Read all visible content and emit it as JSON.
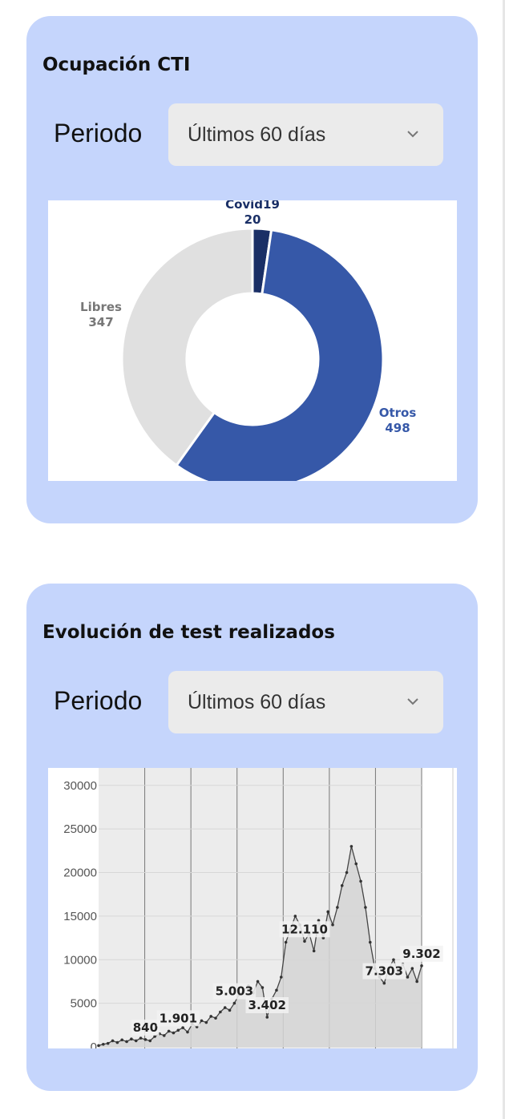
{
  "cti_card": {
    "title": "Ocupación CTI",
    "period_label": "Periodo",
    "period_selected": "Últimos 60 días",
    "chart_data": {
      "type": "pie",
      "donut": true,
      "slices": [
        {
          "label": "Covid19",
          "value": 20,
          "color": "#1a2f66",
          "display": "20"
        },
        {
          "label": "Otros",
          "value": 498,
          "color": "#3658a8",
          "display": "498"
        },
        {
          "label": "Libres",
          "value": 347,
          "color": "#e0e0e0",
          "display": "347"
        }
      ]
    }
  },
  "tests_card": {
    "title": "Evolución de test realizados",
    "period_label": "Periodo",
    "period_selected": "Últimos 60 días",
    "chart_data": {
      "type": "line",
      "ylim": [
        0,
        32000
      ],
      "yticks": [
        0,
        5000,
        10000,
        15000,
        20000,
        25000,
        30000
      ],
      "ytick_labels": [
        "0",
        "5000",
        "10000",
        "15000",
        "20000",
        "25000",
        "30000"
      ],
      "grid": true,
      "series": [
        {
          "x": [
            0,
            1,
            2,
            3,
            4,
            5,
            6,
            7,
            8,
            9,
            10,
            11,
            12,
            13,
            14,
            15,
            16,
            17,
            18,
            19,
            20,
            21,
            22,
            23,
            24,
            25,
            26,
            27,
            28,
            29,
            30,
            31,
            32,
            33,
            34,
            35,
            36,
            37,
            38,
            39,
            40,
            41,
            42,
            43,
            44,
            45,
            46,
            47,
            48,
            49,
            50,
            51,
            52,
            53,
            54,
            55,
            56,
            57,
            58,
            59,
            60,
            61,
            62,
            63,
            64,
            65,
            66,
            67,
            68,
            69
          ],
          "values": [
            150,
            300,
            400,
            700,
            500,
            800,
            600,
            900,
            700,
            1000,
            840,
            700,
            1200,
            1500,
            1300,
            1800,
            1600,
            1901,
            2200,
            1700,
            2600,
            2300,
            3000,
            2800,
            3500,
            3300,
            4000,
            4500,
            4200,
            5003,
            6000,
            6500,
            7000,
            6200,
            7500,
            6800,
            3402,
            5500,
            6500,
            8000,
            12000,
            13500,
            15000,
            14000,
            12110,
            13000,
            11000,
            14500,
            12500,
            15500,
            14000,
            16000,
            18500,
            20000,
            23000,
            21000,
            19000,
            16000,
            12000,
            9000,
            8000,
            7303,
            9000,
            10000,
            8500,
            9500,
            8000,
            9000,
            7500,
            9302
          ]
        }
      ],
      "data_labels": [
        {
          "x": 10,
          "value": 840,
          "text": "840"
        },
        {
          "x": 17,
          "value": 1901,
          "text": "1.901"
        },
        {
          "x": 29,
          "value": 5003,
          "text": "5.003"
        },
        {
          "x": 36,
          "value": 3402,
          "text": "3.402"
        },
        {
          "x": 44,
          "value": 12110,
          "text": "12.110"
        },
        {
          "x": 61,
          "value": 7303,
          "text": "7.303"
        },
        {
          "x": 69,
          "value": 9302,
          "text": "9.302"
        }
      ]
    }
  }
}
